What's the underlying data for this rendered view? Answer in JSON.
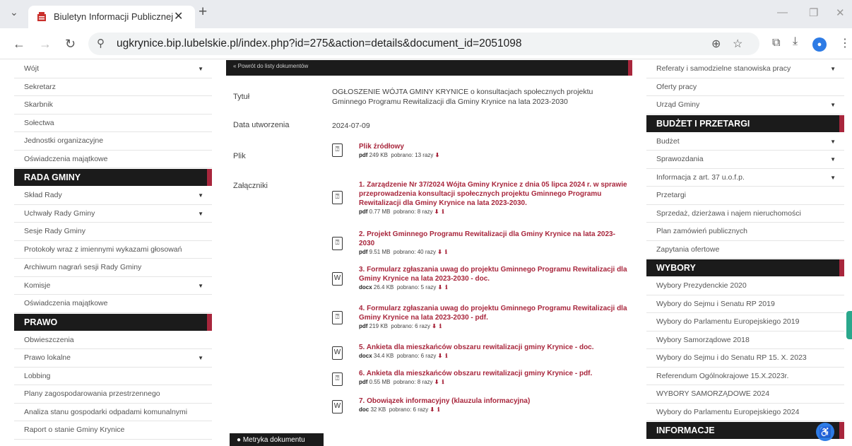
{
  "browser": {
    "tab_title": "Biuletyn Informacji Publicznej",
    "url": "ugkrynice.bip.lubelskie.pl/index.php?id=275&action=details&document_id=2051098"
  },
  "left_menu": {
    "items_top": [
      {
        "label": "Wójt",
        "chev": true
      },
      {
        "label": "Sekretarz",
        "chev": false
      },
      {
        "label": "Skarbnik",
        "chev": false
      },
      {
        "label": "Sołectwa",
        "chev": false
      },
      {
        "label": "Jednostki organizacyjne",
        "chev": false
      },
      {
        "label": "Oświadczenia majątkowe",
        "chev": false
      }
    ],
    "rada_header": "RADA GMINY",
    "rada_items": [
      {
        "label": "Skład Rady",
        "chev": true
      },
      {
        "label": "Uchwały Rady Gminy",
        "chev": true
      },
      {
        "label": "Sesje Rady Gminy",
        "chev": false
      },
      {
        "label": "Protokoły wraz z imiennymi wykazami głosowań",
        "chev": false
      },
      {
        "label": "Archiwum nagrań sesji Rady Gminy",
        "chev": false
      },
      {
        "label": "Komisje",
        "chev": true
      },
      {
        "label": "Oświadczenia majątkowe",
        "chev": false
      }
    ],
    "prawo_header": "PRAWO",
    "prawo_items": [
      {
        "label": "Obwieszczenia",
        "chev": false
      },
      {
        "label": "Prawo lokalne",
        "chev": true
      },
      {
        "label": "Lobbing",
        "chev": false
      },
      {
        "label": "Plany zagospodarowania przestrzennego",
        "chev": false
      },
      {
        "label": "Analiza stanu gospodarki odpadami komunalnymi",
        "chev": false
      },
      {
        "label": "Raport o stanie Gminy Krynice",
        "chev": false
      }
    ]
  },
  "document": {
    "top_link": "« Powrót do listy dokumentów",
    "title_label": "Tytuł",
    "title_value": "OGŁOSZENIE WÓJTA GMINY KRYNICE o konsultacjach społecznych projektu Gminnego Programu Rewitalizacji dla Gminy Krynice na lata 2023-2030",
    "date_label": "Data utworzenia",
    "date_value": "2024-07-09",
    "file_label": "Plik",
    "file": {
      "name": "Plik źródłowy",
      "ext": "pdf",
      "size": "249 KB",
      "downloads": "pobrano: 13 razy"
    },
    "attach_label": "Załączniki",
    "attachments": [
      {
        "icon": "pdf",
        "title": "1. Zarządzenie Nr 37/2024 Wójta Gminy Krynice z dnia 05 lipca 2024 r. w sprawie przeprowadzenia konsultacji społecznych projektu Gminnego Programu Rewitalizacji dla Gminy Krynice na lata 2023-2030.",
        "ext": "pdf",
        "size": "0.77 MB",
        "downloads": "pobrano: 8 razy"
      },
      {
        "icon": "pdf",
        "title": "2. Projekt Gminnego Programu Rewitalizacji dla Gminy Krynice na lata 2023-2030",
        "ext": "pdf",
        "size": "9.51 MB",
        "downloads": "pobrano: 40 razy"
      },
      {
        "icon": "docx",
        "title": "3. Formularz zgłaszania uwag do projektu Gminnego Programu Rewitalizacji dla Gminy Krynice na lata 2023-2030 - doc.",
        "ext": "docx",
        "size": "26.4 KB",
        "downloads": "pobrano: 5 razy"
      },
      {
        "icon": "pdf",
        "title": "4. Formularz zgłaszania uwag do projektu Gminnego Programu Rewitalizacji dla Gminy Krynice na lata 2023-2030 - pdf.",
        "ext": "pdf",
        "size": "219 KB",
        "downloads": "pobrano: 6 razy"
      },
      {
        "icon": "docx",
        "title": "5. Ankieta dla mieszkańców obszaru rewitalizacji gminy Krynice - doc.",
        "ext": "docx",
        "size": "34.4 KB",
        "downloads": "pobrano: 6 razy"
      },
      {
        "icon": "pdf",
        "title": "6. Ankieta dla mieszkańców obszaru rewitalizacji gminy Krynice - pdf.",
        "ext": "pdf",
        "size": "0.55 MB",
        "downloads": "pobrano: 8 razy"
      },
      {
        "icon": "docx",
        "title": "7. Obowiązek informacyjny (klauzula informacyjna)",
        "ext": "doc",
        "size": "32 KB",
        "downloads": "pobrano: 6 razy"
      }
    ],
    "metryka_button": "Metryka dokumentu"
  },
  "right_menu": {
    "items_top": [
      {
        "label": "Referaty i samodzielne stanowiska pracy",
        "chev": true
      },
      {
        "label": "Oferty pracy",
        "chev": false
      },
      {
        "label": "Urząd Gminy",
        "chev": true
      }
    ],
    "budzet_header": "BUDŻET I PRZETARGI",
    "budzet_items": [
      {
        "label": "Budżet",
        "chev": true
      },
      {
        "label": "Sprawozdania",
        "chev": true
      },
      {
        "label": "Informacja z art. 37 u.o.f.p.",
        "chev": true
      },
      {
        "label": "Przetargi",
        "chev": false
      },
      {
        "label": "Sprzedaż, dzierżawa i najem nieruchomości",
        "chev": false
      },
      {
        "label": "Plan zamówień publicznych",
        "chev": false
      },
      {
        "label": "Zapytania ofertowe",
        "chev": false
      }
    ],
    "wybory_header": "WYBORY",
    "wybory_items": [
      {
        "label": "Wybory Prezydenckie 2020",
        "chev": false
      },
      {
        "label": "Wybory do Sejmu i Senatu RP 2019",
        "chev": false
      },
      {
        "label": "Wybory do Parlamentu Europejskiego 2019",
        "chev": false
      },
      {
        "label": "Wybory Samorządowe 2018",
        "chev": false
      },
      {
        "label": "Wybory do Sejmu i do Senatu RP 15. X. 2023",
        "chev": false
      },
      {
        "label": "Referendum Ogólnokrajowe 15.X.2023r.",
        "chev": false
      },
      {
        "label": "WYBORY SAMORZĄDOWE 2024",
        "chev": false
      },
      {
        "label": "Wybory do Parlamentu Europejskiego 2024",
        "chev": false
      }
    ],
    "informacje_header": "INFORMACJE"
  }
}
